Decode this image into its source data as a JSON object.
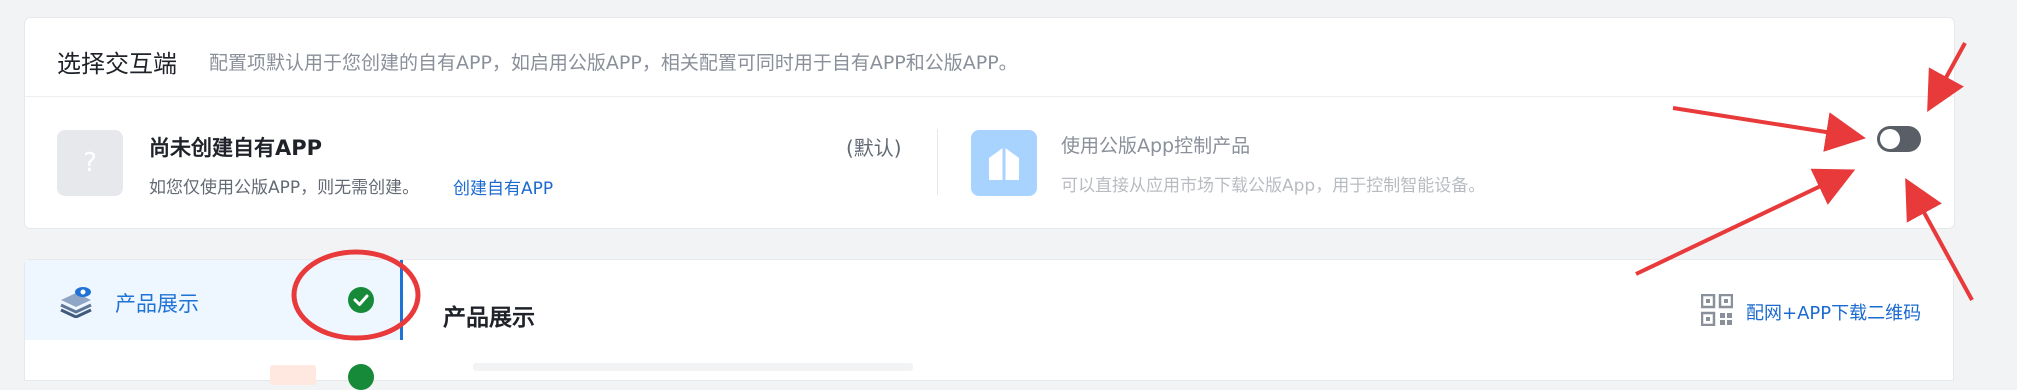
{
  "header": {
    "title": "选择交互端",
    "description": "配置项默认用于您创建的自有APP，如启用公版APP，相关配置可同时用于自有APP和公版APP。"
  },
  "own_app": {
    "icon_glyph": "?",
    "name": "尚未创建自有APP",
    "subtitle": "如您仅使用公版APP，则无需创建。",
    "link_label": "创建自有APP",
    "default_label": "(默认)"
  },
  "public_app": {
    "name": "使用公版App控制产品",
    "subtitle": "可以直接从应用市场下载公版App，用于控制智能设备。",
    "toggle_state": "off"
  },
  "sidebar": {
    "items": [
      {
        "label": "产品展示",
        "status": "complete"
      }
    ]
  },
  "main": {
    "title": "产品展示",
    "qr_link_label": "配网+APP下载二维码"
  },
  "colors": {
    "accent": "#1f73d6",
    "link": "#1a6ad1",
    "success": "#178a3a",
    "annotation": "#e83a3a"
  }
}
